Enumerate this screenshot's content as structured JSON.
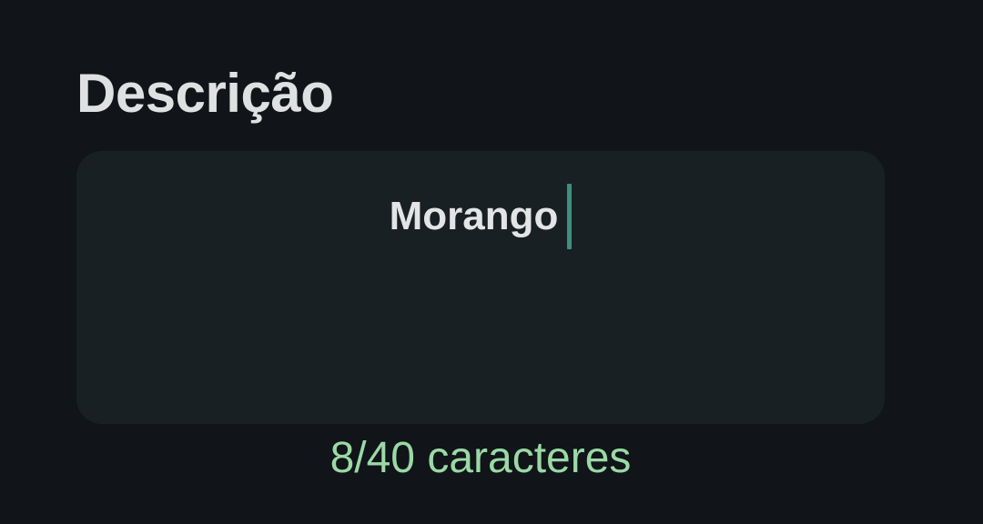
{
  "form": {
    "description_label": "Descrição",
    "description_value": "Morango",
    "char_counter": "8/40 caracteres"
  },
  "colors": {
    "background": "#111418",
    "field_background": "#192024",
    "label": "#dfe0e2",
    "input_text": "#e3e4e6",
    "caret": "#3f8f80",
    "counter": "#9ad9a6"
  }
}
